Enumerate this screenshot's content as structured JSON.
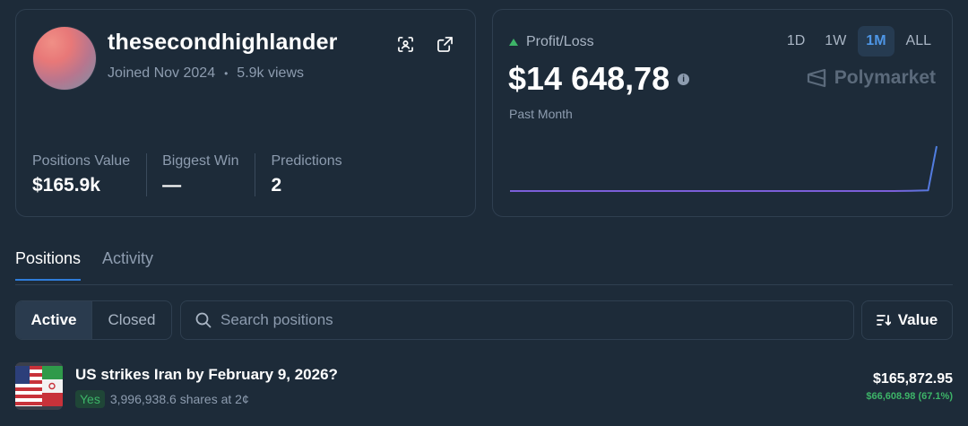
{
  "profile": {
    "username": "thesecondhighlander",
    "joined": "Joined Nov 2024",
    "separator": "•",
    "views": "5.9k views",
    "stats": [
      {
        "label": "Positions Value",
        "value": "$165.9k"
      },
      {
        "label": "Biggest Win",
        "value": "—"
      },
      {
        "label": "Predictions",
        "value": "2"
      }
    ]
  },
  "pnl": {
    "label": "Profit/Loss",
    "value": "$14 648,78",
    "period": "Past Month",
    "timeframes": [
      "1D",
      "1W",
      "1M",
      "ALL"
    ],
    "active_timeframe": "1M",
    "brand": "Polymarket",
    "trend": "up",
    "chart_color": "#7b5fd9"
  },
  "chart_data": {
    "type": "line",
    "title": "",
    "xlabel": "",
    "ylabel": "",
    "x": [
      0,
      10,
      20,
      30,
      40,
      50,
      60,
      70,
      80,
      90,
      92,
      94,
      96,
      98,
      100
    ],
    "values": [
      0,
      0,
      0,
      0,
      0,
      0,
      0,
      0,
      0,
      0,
      0.3,
      1,
      3,
      8,
      14648.78
    ],
    "series_note": ""
  },
  "tabs": {
    "positions": "Positions",
    "activity": "Activity"
  },
  "filters": {
    "active": "Active",
    "closed": "Closed",
    "search_placeholder": "Search positions",
    "sort_label": "Value"
  },
  "positions": [
    {
      "title": "US strikes Iran by February 9, 2026?",
      "outcome": "Yes",
      "shares": "3,996,938.6 shares at 2¢",
      "value": "$165,872.95",
      "pnl": "$66,608.98 (67.1%)"
    }
  ],
  "colors": {
    "background": "#1d2b39",
    "accent": "#2e7cd9",
    "positive": "#3db468",
    "muted": "#8d9caf"
  }
}
